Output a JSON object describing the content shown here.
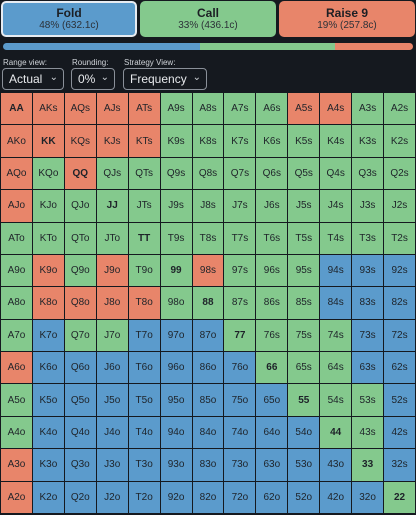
{
  "colors": {
    "fold": "#5b9bcc",
    "call": "#84c98d",
    "raise": "#e8856a"
  },
  "actions": [
    {
      "name": "Fold",
      "pct": "48% (632.1c)",
      "color": "#5b9bcc",
      "selected": true
    },
    {
      "name": "Call",
      "pct": "33% (436.1c)",
      "color": "#84c98d",
      "selected": false
    },
    {
      "name": "Raise 9",
      "pct": "19% (257.8c)",
      "color": "#e8856a",
      "selected": false
    }
  ],
  "freq_bar": [
    0.48,
    0.33,
    0.19
  ],
  "controls": {
    "range_view": {
      "label": "Range view:",
      "value": "Actual"
    },
    "rounding": {
      "label": "Rounding:",
      "value": "0%"
    },
    "strategy_view": {
      "label": "Strategy View:",
      "value": "Frequency"
    }
  },
  "hands": [
    [
      "AA",
      "AKs",
      "AQs",
      "AJs",
      "ATs",
      "A9s",
      "A8s",
      "A7s",
      "A6s",
      "A5s",
      "A4s",
      "A3s",
      "A2s"
    ],
    [
      "AKo",
      "KK",
      "KQs",
      "KJs",
      "KTs",
      "K9s",
      "K8s",
      "K7s",
      "K6s",
      "K5s",
      "K4s",
      "K3s",
      "K2s"
    ],
    [
      "AQo",
      "KQo",
      "QQ",
      "QJs",
      "QTs",
      "Q9s",
      "Q8s",
      "Q7s",
      "Q6s",
      "Q5s",
      "Q4s",
      "Q3s",
      "Q2s"
    ],
    [
      "AJo",
      "KJo",
      "QJo",
      "JJ",
      "JTs",
      "J9s",
      "J8s",
      "J7s",
      "J6s",
      "J5s",
      "J4s",
      "J3s",
      "J2s"
    ],
    [
      "ATo",
      "KTo",
      "QTo",
      "JTo",
      "TT",
      "T9s",
      "T8s",
      "T7s",
      "T6s",
      "T5s",
      "T4s",
      "T3s",
      "T2s"
    ],
    [
      "A9o",
      "K9o",
      "Q9o",
      "J9o",
      "T9o",
      "99",
      "98s",
      "97s",
      "96s",
      "95s",
      "94s",
      "93s",
      "92s"
    ],
    [
      "A8o",
      "K8o",
      "Q8o",
      "J8o",
      "T8o",
      "98o",
      "88",
      "87s",
      "86s",
      "85s",
      "84s",
      "83s",
      "82s"
    ],
    [
      "A7o",
      "K7o",
      "Q7o",
      "J7o",
      "T7o",
      "97o",
      "87o",
      "77",
      "76s",
      "75s",
      "74s",
      "73s",
      "72s"
    ],
    [
      "A6o",
      "K6o",
      "Q6o",
      "J6o",
      "T6o",
      "96o",
      "86o",
      "76o",
      "66",
      "65s",
      "64s",
      "63s",
      "62s"
    ],
    [
      "A5o",
      "K5o",
      "Q5o",
      "J5o",
      "T5o",
      "95o",
      "85o",
      "75o",
      "65o",
      "55",
      "54s",
      "53s",
      "52s"
    ],
    [
      "A4o",
      "K4o",
      "Q4o",
      "J4o",
      "T4o",
      "94o",
      "84o",
      "74o",
      "64o",
      "54o",
      "44",
      "43s",
      "42s"
    ],
    [
      "A3o",
      "K3o",
      "Q3o",
      "J3o",
      "T3o",
      "93o",
      "83o",
      "73o",
      "63o",
      "53o",
      "43o",
      "33",
      "32s"
    ],
    [
      "A2o",
      "K2o",
      "Q2o",
      "J2o",
      "T2o",
      "92o",
      "82o",
      "72o",
      "62o",
      "52o",
      "42o",
      "32o",
      "22"
    ]
  ],
  "strategy": [
    [
      "R",
      "R",
      "R",
      "R",
      "R",
      "C",
      "C",
      "C",
      "C",
      "R",
      "R",
      "C",
      "C"
    ],
    [
      "R",
      "R",
      "R",
      "R",
      "R",
      "C",
      "C",
      "C",
      "C",
      "C",
      "C",
      "C",
      "C"
    ],
    [
      "R",
      "C",
      "R",
      "C",
      "C",
      "C",
      "C",
      "C",
      "C",
      "C",
      "C",
      "C",
      "C"
    ],
    [
      "R",
      "C",
      "C",
      "C",
      "C",
      "C",
      "C",
      "C",
      "C",
      "C",
      "C",
      "C",
      "C"
    ],
    [
      "C",
      "C",
      "C",
      "C",
      "C",
      "C",
      "C",
      "C",
      "C",
      "C",
      "C",
      "C",
      "C"
    ],
    [
      "C",
      "R",
      "C",
      "R",
      "C",
      "C",
      "R",
      "C",
      "C",
      "C",
      "F",
      "F",
      "F"
    ],
    [
      "C",
      "R",
      "R",
      "R",
      "R",
      "C",
      "C",
      "C",
      "C",
      "C",
      "F",
      "F",
      "F"
    ],
    [
      "C",
      "F",
      "C",
      "C",
      "F",
      "F",
      "F",
      "C",
      "C",
      "C",
      "C",
      "F",
      "F"
    ],
    [
      "R",
      "F",
      "F",
      "F",
      "F",
      "F",
      "F",
      "F",
      "C",
      "C",
      "C",
      "F",
      "F"
    ],
    [
      "C",
      "F",
      "F",
      "F",
      "F",
      "F",
      "F",
      "F",
      "F",
      "C",
      "C",
      "C",
      "F"
    ],
    [
      "C",
      "F",
      "F",
      "F",
      "F",
      "F",
      "F",
      "F",
      "F",
      "F",
      "C",
      "C",
      "F"
    ],
    [
      "R",
      "F",
      "F",
      "F",
      "F",
      "F",
      "F",
      "F",
      "F",
      "F",
      "F",
      "C",
      "F"
    ],
    [
      "R",
      "F",
      "F",
      "F",
      "F",
      "F",
      "F",
      "F",
      "F",
      "F",
      "F",
      "F",
      "C"
    ]
  ]
}
